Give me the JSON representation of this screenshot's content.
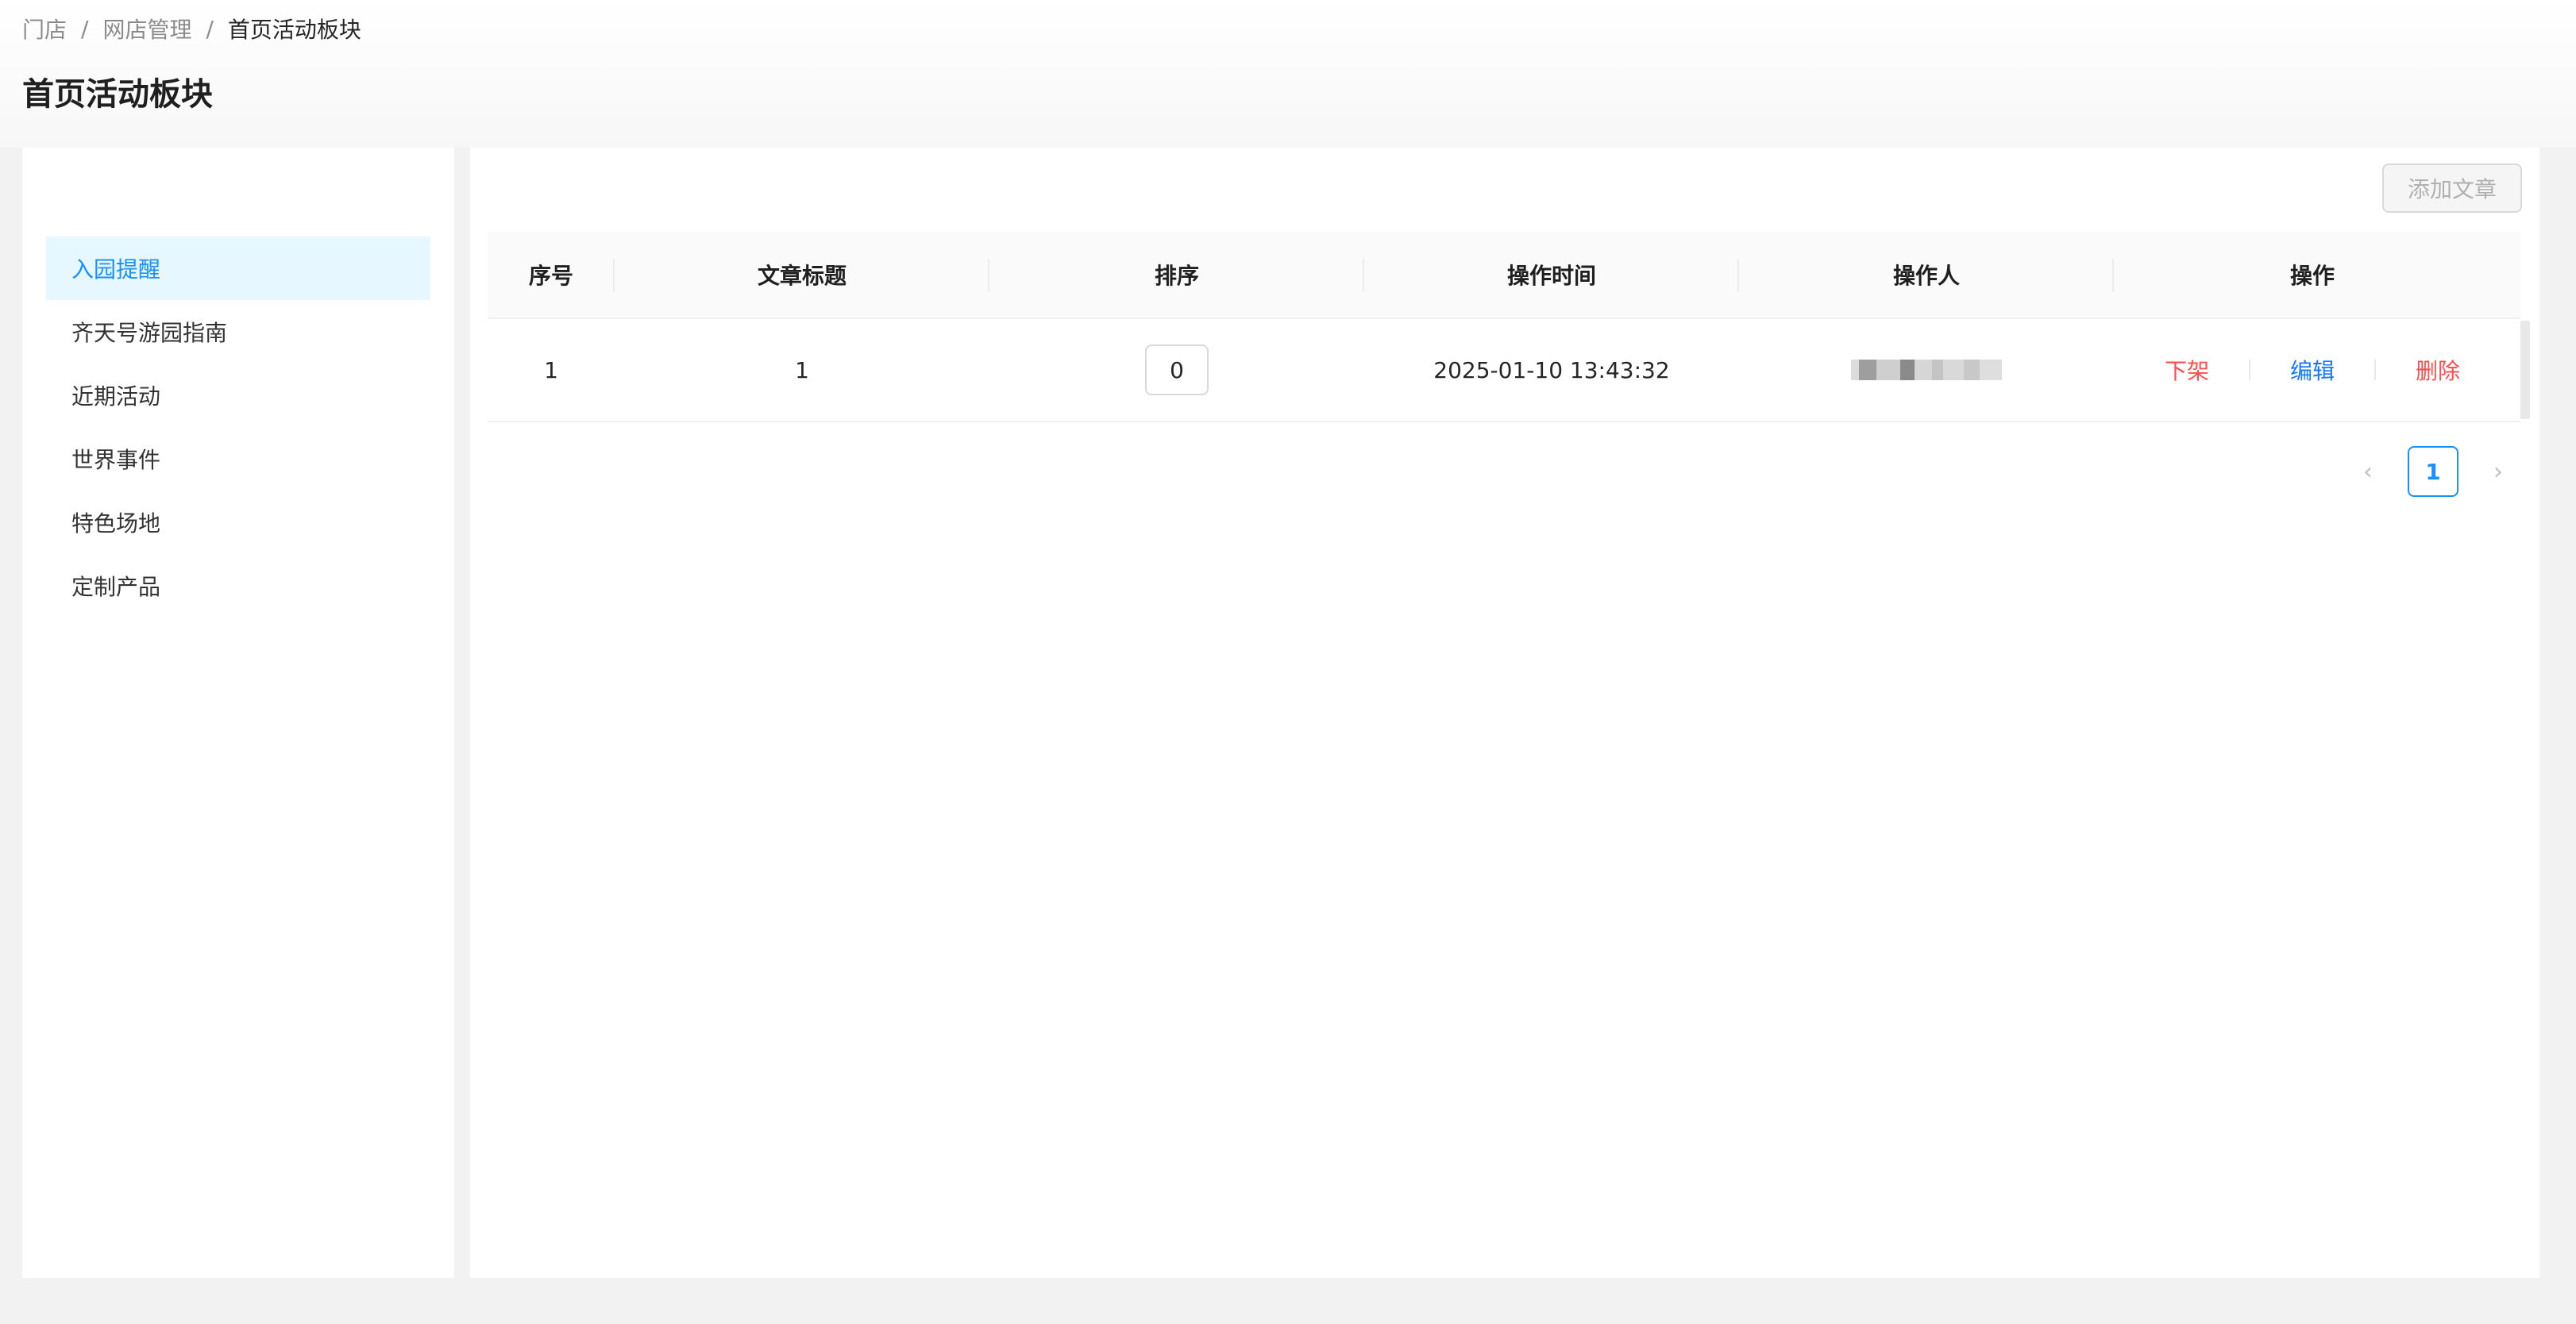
{
  "breadcrumb": {
    "items": [
      "门店",
      "网店管理",
      "首页活动板块"
    ],
    "separator": "/"
  },
  "page": {
    "title": "首页活动板块"
  },
  "sidebar": {
    "items": [
      {
        "label": "入园提醒",
        "active": true
      },
      {
        "label": "齐天号游园指南",
        "active": false
      },
      {
        "label": "近期活动",
        "active": false
      },
      {
        "label": "世界事件",
        "active": false
      },
      {
        "label": "特色场地",
        "active": false
      },
      {
        "label": "定制产品",
        "active": false
      }
    ]
  },
  "toolbar": {
    "add_label": "添加文章"
  },
  "table": {
    "columns": [
      "序号",
      "文章标题",
      "排序",
      "操作时间",
      "操作人",
      "操作"
    ],
    "rows": [
      {
        "index": "1",
        "title": "1",
        "sort": "0",
        "time": "2025-01-10 13:43:32",
        "operator": "",
        "actions": [
          "下架",
          "编辑",
          "删除"
        ]
      }
    ]
  },
  "pagination": {
    "current": "1",
    "prev_icon": "chevron-left-icon",
    "next_icon": "chevron-right-icon"
  },
  "colors": {
    "accent": "#1890ff",
    "danger": "#ff4d4f",
    "active_bg": "#e6f7ff"
  }
}
